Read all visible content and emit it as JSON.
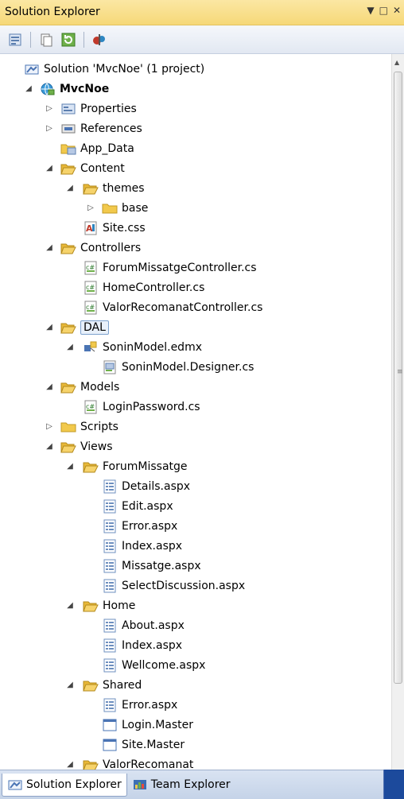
{
  "window": {
    "title": "Solution Explorer",
    "ctrl_pin": "▼",
    "ctrl_max": "□",
    "ctrl_close": "✕"
  },
  "toolbar": {
    "buttons": [
      {
        "icon": "properties-icon"
      },
      {
        "icon": "show-all-files-icon"
      },
      {
        "icon": "refresh-icon"
      },
      {
        "icon": "class-diagram-icon"
      }
    ]
  },
  "tree": [
    {
      "label": "Solution 'MvcNoe' (1 project)",
      "icon": "solution-icon",
      "expander": "none",
      "depth": 0
    },
    {
      "label": "MvcNoe",
      "icon": "web-project-icon",
      "expander": "expanded",
      "depth": 0,
      "bold": true
    },
    {
      "label": "Properties",
      "icon": "properties-folder-icon",
      "expander": "collapsed",
      "depth": 1
    },
    {
      "label": "References",
      "icon": "references-icon",
      "expander": "collapsed",
      "depth": 1
    },
    {
      "label": "App_Data",
      "icon": "app-data-folder-icon",
      "expander": "none",
      "depth": 1
    },
    {
      "label": "Content",
      "icon": "folder-open-icon",
      "expander": "expanded",
      "depth": 1
    },
    {
      "label": "themes",
      "icon": "folder-open-icon",
      "expander": "expanded",
      "depth": 2
    },
    {
      "label": "base",
      "icon": "folder-icon",
      "expander": "collapsed",
      "depth": 3
    },
    {
      "label": "Site.css",
      "icon": "css-file-icon",
      "expander": "none",
      "depth": 2
    },
    {
      "label": "Controllers",
      "icon": "folder-open-icon",
      "expander": "expanded",
      "depth": 1
    },
    {
      "label": "ForumMissatgeController.cs",
      "icon": "cs-file-icon",
      "expander": "none",
      "depth": 2
    },
    {
      "label": "HomeController.cs",
      "icon": "cs-file-icon",
      "expander": "none",
      "depth": 2
    },
    {
      "label": "ValorRecomanatController.cs",
      "icon": "cs-file-icon",
      "expander": "none",
      "depth": 2
    },
    {
      "label": "DAL",
      "icon": "folder-open-icon",
      "expander": "expanded",
      "depth": 1,
      "selected": true
    },
    {
      "label": "SoninModel.edmx",
      "icon": "edmx-file-icon",
      "expander": "expanded",
      "depth": 2
    },
    {
      "label": "SoninModel.Designer.cs",
      "icon": "designer-file-icon",
      "expander": "none",
      "depth": 3
    },
    {
      "label": "Models",
      "icon": "folder-open-icon",
      "expander": "expanded",
      "depth": 1
    },
    {
      "label": "LoginPassword.cs",
      "icon": "cs-file-icon",
      "expander": "none",
      "depth": 2
    },
    {
      "label": "Scripts",
      "icon": "folder-icon",
      "expander": "collapsed",
      "depth": 1
    },
    {
      "label": "Views",
      "icon": "folder-open-icon",
      "expander": "expanded",
      "depth": 1
    },
    {
      "label": "ForumMissatge",
      "icon": "folder-open-icon",
      "expander": "expanded",
      "depth": 2
    },
    {
      "label": "Details.aspx",
      "icon": "aspx-file-icon",
      "expander": "none",
      "depth": 3
    },
    {
      "label": "Edit.aspx",
      "icon": "aspx-file-icon",
      "expander": "none",
      "depth": 3
    },
    {
      "label": "Error.aspx",
      "icon": "aspx-file-icon",
      "expander": "none",
      "depth": 3
    },
    {
      "label": "Index.aspx",
      "icon": "aspx-file-icon",
      "expander": "none",
      "depth": 3
    },
    {
      "label": "Missatge.aspx",
      "icon": "aspx-file-icon",
      "expander": "none",
      "depth": 3
    },
    {
      "label": "SelectDiscussion.aspx",
      "icon": "aspx-file-icon",
      "expander": "none",
      "depth": 3
    },
    {
      "label": "Home",
      "icon": "folder-open-icon",
      "expander": "expanded",
      "depth": 2
    },
    {
      "label": "About.aspx",
      "icon": "aspx-file-icon",
      "expander": "none",
      "depth": 3
    },
    {
      "label": "Index.aspx",
      "icon": "aspx-file-icon",
      "expander": "none",
      "depth": 3
    },
    {
      "label": "Wellcome.aspx",
      "icon": "aspx-file-icon",
      "expander": "none",
      "depth": 3
    },
    {
      "label": "Shared",
      "icon": "folder-open-icon",
      "expander": "expanded",
      "depth": 2
    },
    {
      "label": "Error.aspx",
      "icon": "aspx-file-icon",
      "expander": "none",
      "depth": 3
    },
    {
      "label": "Login.Master",
      "icon": "master-page-icon",
      "expander": "none",
      "depth": 3
    },
    {
      "label": "Site.Master",
      "icon": "master-page-icon",
      "expander": "none",
      "depth": 3
    },
    {
      "label": "ValorRecomanat",
      "icon": "folder-open-icon",
      "expander": "expanded",
      "depth": 2
    }
  ],
  "tabs": [
    {
      "label": "Solution Explorer",
      "icon": "solution-explorer-icon",
      "active": true
    },
    {
      "label": "Team Explorer",
      "icon": "team-explorer-icon",
      "active": false
    }
  ],
  "colors": {
    "folder": "#f2c94c",
    "accent": "#3c6fb4",
    "selection": "#7da2ce"
  }
}
